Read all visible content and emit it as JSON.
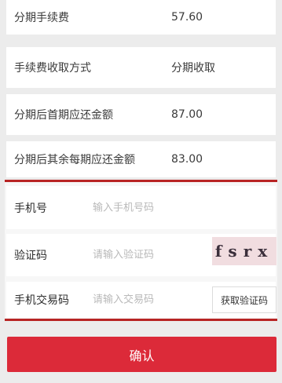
{
  "installment_info": [
    {
      "label": "分期手续费",
      "value": "57.60"
    },
    {
      "label": "手续费收取方式",
      "value": "分期收取"
    },
    {
      "label": "分期后首期应还金额",
      "value": "87.00"
    },
    {
      "label": "分期后其余每期应还金额",
      "value": "83.00"
    }
  ],
  "form": {
    "phone": {
      "label": "手机号",
      "placeholder": "输入手机号码"
    },
    "captcha": {
      "label": "验证码",
      "placeholder": "请输入验证码",
      "captcha_text": "fsrx"
    },
    "sms_code": {
      "label": "手机交易码",
      "placeholder": "请输入交易码",
      "button_label": "获取验证码"
    }
  },
  "confirm_label": "确认",
  "colors": {
    "accent_red": "#dc2a39",
    "border_red": "#b82424",
    "captcha_bg": "#f1dde0"
  }
}
